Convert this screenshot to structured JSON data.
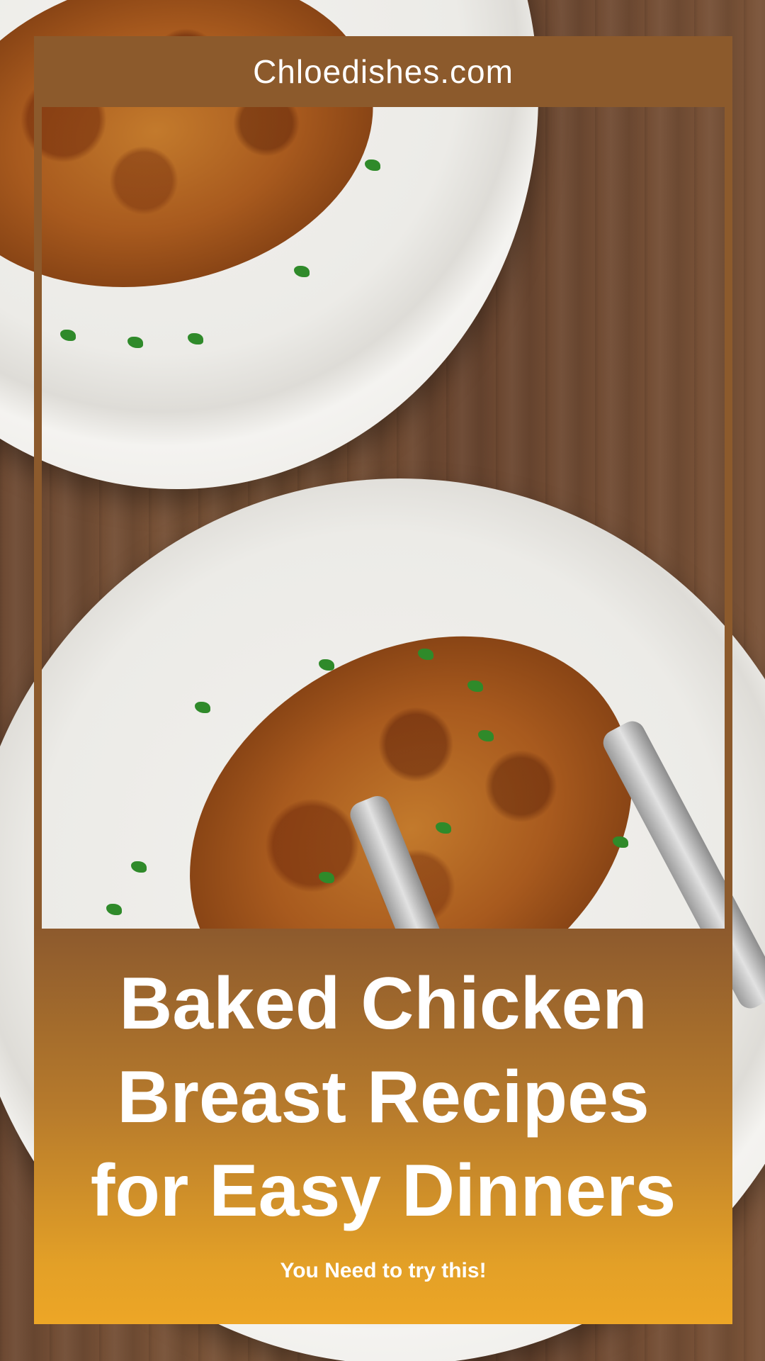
{
  "header": {
    "site_name": "Chloedishes.com"
  },
  "title": {
    "lines": [
      "Baked Chicken",
      "Breast Recipes",
      "for Easy Dinners"
    ]
  },
  "subtitle": "You Need to try this!",
  "colors": {
    "frame_brown": "#8c5a2c",
    "gradient_top": "#8d5a2d",
    "gradient_bottom": "#eda626",
    "text": "#ffffff"
  }
}
